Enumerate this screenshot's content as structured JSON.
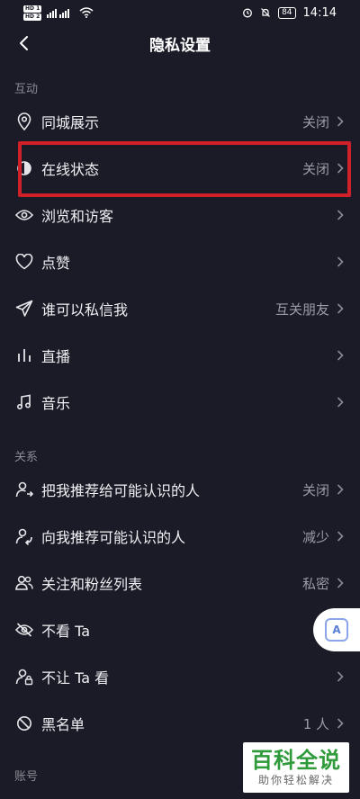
{
  "status": {
    "hd1": "HD 1",
    "hd2": "HD 2",
    "signal_text": "5G",
    "battery": "84",
    "time": "14:14"
  },
  "header": {
    "title": "隐私设置"
  },
  "sections": {
    "interaction": "互动",
    "relation": "关系",
    "account": "账号"
  },
  "rows": {
    "same_city": {
      "label": "同城展示",
      "value": "关闭"
    },
    "online_status": {
      "label": "在线状态",
      "value": "关闭"
    },
    "browse_visitors": {
      "label": "浏览和访客",
      "value": ""
    },
    "likes": {
      "label": "点赞",
      "value": ""
    },
    "who_dm": {
      "label": "谁可以私信我",
      "value": "互关朋友"
    },
    "live": {
      "label": "直播",
      "value": ""
    },
    "music": {
      "label": "音乐",
      "value": ""
    },
    "recommend_me": {
      "label": "把我推荐给可能认识的人",
      "value": "关闭"
    },
    "recommend_to_me": {
      "label": "向我推荐可能认识的人",
      "value": "减少"
    },
    "follow_list": {
      "label": "关注和粉丝列表",
      "value": "私密"
    },
    "not_see": {
      "label": "不看 Ta",
      "value": ""
    },
    "not_let_see": {
      "label": "不让 Ta 看",
      "value": ""
    },
    "blacklist": {
      "label": "黑名单",
      "value": "1 人"
    }
  },
  "float_button": {
    "label": "A"
  },
  "watermark": {
    "main": "百科全说",
    "sub": "助你轻松解决"
  }
}
